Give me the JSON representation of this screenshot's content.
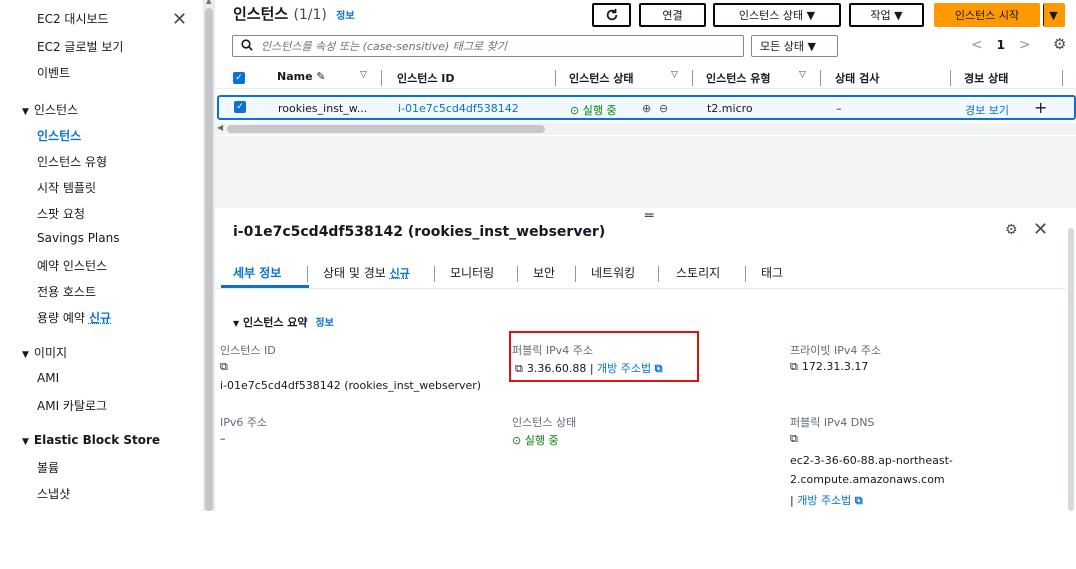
{
  "sidebar": {
    "top_item": "EC2 대시보드",
    "global_view": "EC2 글로벌 보기",
    "events": "이벤트",
    "sections": [
      {
        "label": "인스턴스",
        "items": [
          "인스턴스",
          "인스턴스 유형",
          "시작 템플릿",
          "스팟 요청",
          "Savings Plans",
          "예약 인스턴스",
          "전용 호스트",
          "용량 예약"
        ]
      },
      {
        "label": "이미지",
        "items": [
          "AMI",
          "AMI 카탈로그"
        ]
      },
      {
        "label": "Elastic Block Store",
        "items": [
          "볼륨",
          "스냅샷"
        ]
      }
    ],
    "new_badge": "신규",
    "active_item": "인스턴스"
  },
  "list": {
    "title": "인스턴스",
    "count": "(1/1)",
    "info": "정보",
    "buttons": {
      "refresh_icon": "refresh-icon",
      "connect": "연결",
      "instance_state": "인스턴스 상태 ▼",
      "actions": "작업 ▼",
      "launch": "인스턴스 시작",
      "launch_dropdown": "▼"
    },
    "search_placeholder": "인스턴스를 속성 또는 (case-sensitive) 태그로 찾기",
    "filter": "모든 상태 ▼",
    "pager": {
      "prev": "<",
      "page": "1",
      "next": ">"
    },
    "columns": [
      "Name",
      "인스턴스 ID",
      "인스턴스 상태",
      "인스턴스 유형",
      "상태 검사",
      "경보 상태"
    ],
    "row": {
      "name": "rookies_inst_w...",
      "id": "i-01e7c5cd4df538142",
      "state": "실행 중",
      "type": "t2.micro",
      "check": "–",
      "alarm": "경보 보기",
      "add": "+"
    }
  },
  "details": {
    "title": "i-01e7c5cd4df538142 (rookies_inst_webserver)",
    "tabs": [
      "세부 정보",
      "상태 및 경보",
      "모니터링",
      "보안",
      "네트워킹",
      "스토리지",
      "태그"
    ],
    "tab_new": "신규",
    "summary_head": "인스턴스 요약",
    "summary_info": "정보",
    "fields": {
      "instance_id_label": "인스턴스 ID",
      "instance_id_value": "i-01e7c5cd4df538142 (rookies_inst_webserver)",
      "public_ipv4_label": "퍼블릭 IPv4 주소",
      "public_ipv4_value": "3.36.60.88",
      "open_address": "개방 주소법",
      "private_ipv4_label": "프라이빗 IPv4 주소",
      "private_ipv4_value": "172.31.3.17",
      "ipv6_label": "IPv6 주소",
      "ipv6_value": "–",
      "state_label": "인스턴스 상태",
      "state_value": "실행 중",
      "public_dns_label": "퍼블릭 IPv4 DNS",
      "public_dns_line1": "ec2-3-36-60-88.ap-northeast-",
      "public_dns_line2": "2.compute.amazonaws.com",
      "public_dns_open": "개방 주소법"
    }
  }
}
